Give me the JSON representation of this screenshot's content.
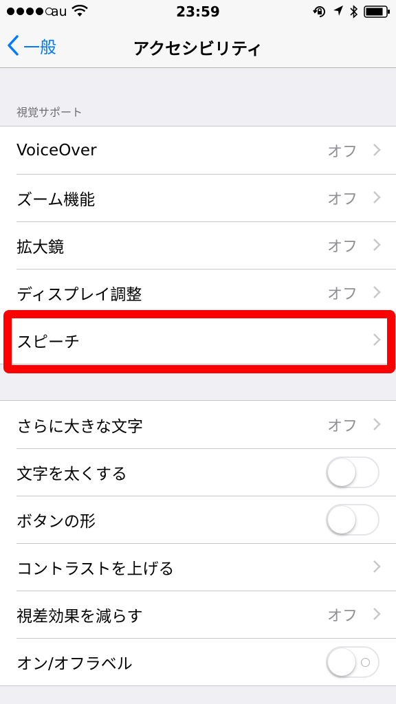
{
  "status_bar": {
    "carrier": "au",
    "time": "23:59",
    "signal_bars": 4
  },
  "nav": {
    "back_label": "一般",
    "title": "アクセシビリティ"
  },
  "section_vision": {
    "header": "視覚サポート",
    "items": [
      {
        "label": "VoiceOver",
        "value": "オフ"
      },
      {
        "label": "ズーム機能",
        "value": "オフ"
      },
      {
        "label": "拡大鏡",
        "value": "オフ"
      },
      {
        "label": "ディスプレイ調整",
        "value": "オフ"
      },
      {
        "label": "スピーチ",
        "value": ""
      }
    ]
  },
  "section_text": {
    "items": [
      {
        "label": "さらに大きな文字",
        "value": "オフ"
      },
      {
        "label": "文字を太くする",
        "toggle": false
      },
      {
        "label": "ボタンの形",
        "toggle": false
      },
      {
        "label": "コントラストを上げる",
        "value": ""
      },
      {
        "label": "視差効果を減らす",
        "value": "オフ"
      },
      {
        "label": "オン/オフラベル",
        "toggle": false
      }
    ]
  },
  "colors": {
    "accent": "#007aff",
    "highlight": "#ff0000"
  }
}
